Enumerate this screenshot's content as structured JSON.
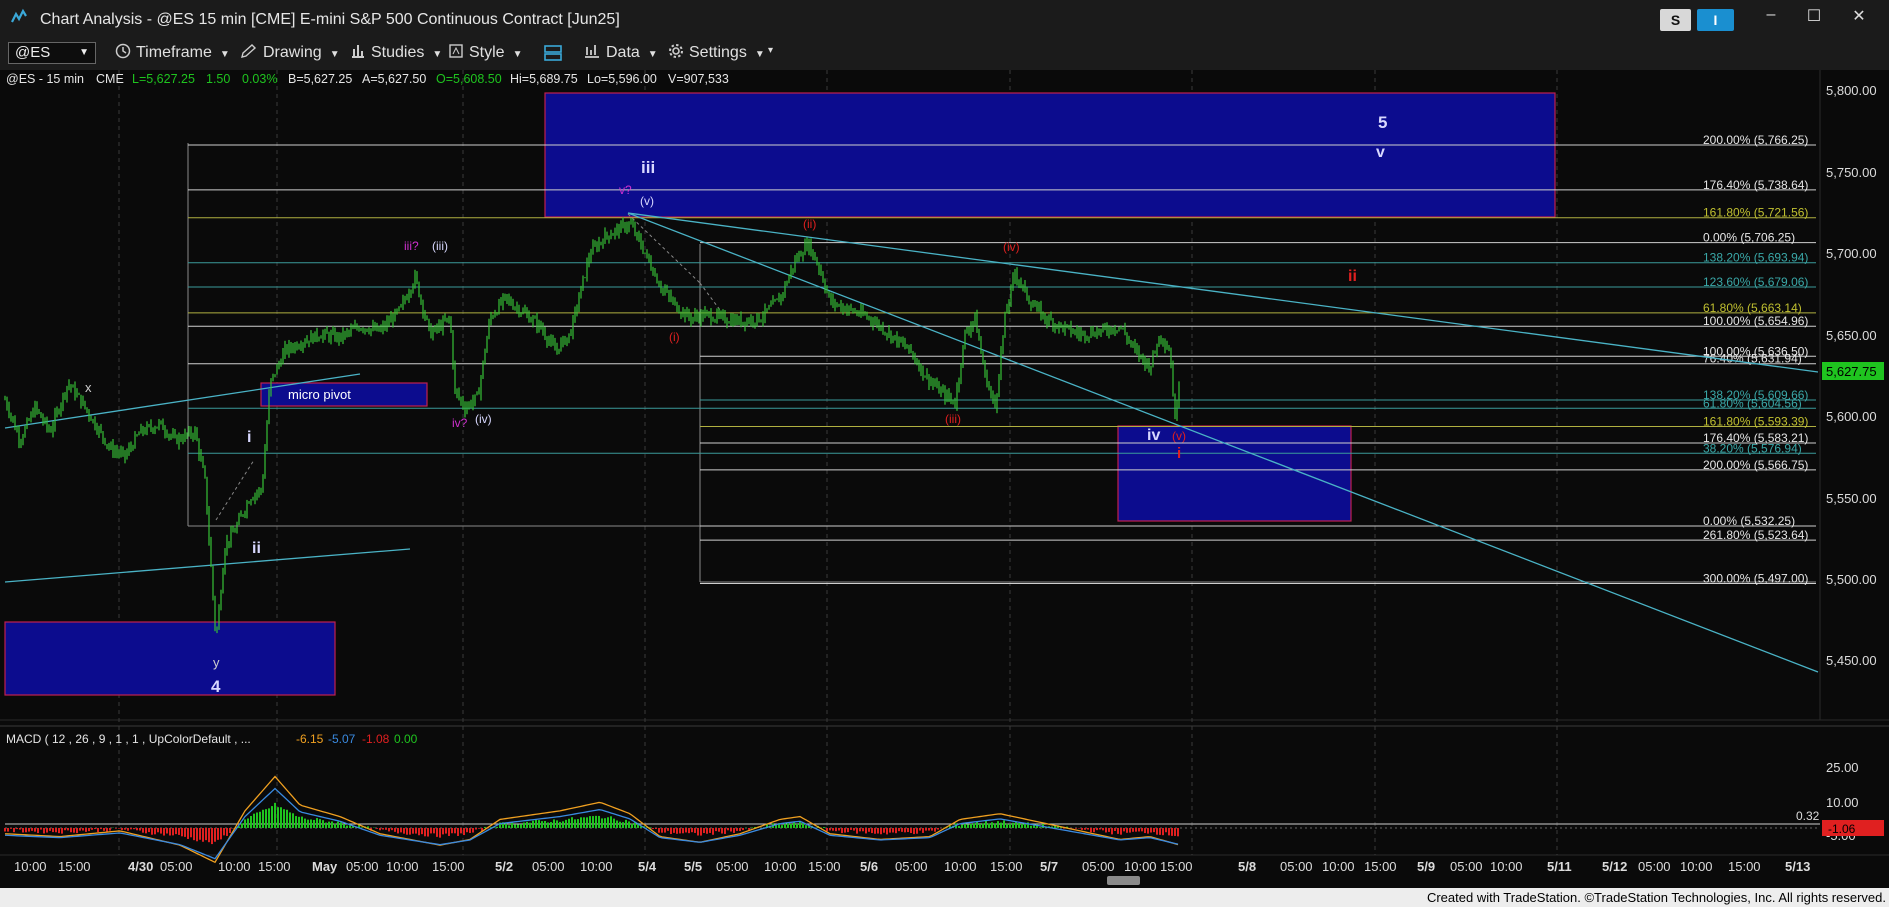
{
  "window": {
    "title": "Chart Analysis - @ES 15 min [CME] E-mini S&P 500 Continuous Contract [Jun25]",
    "buttons": {
      "s": "S",
      "i": "I"
    },
    "controls": {
      "minimize": "–",
      "maximize": "☐",
      "close": "✕"
    }
  },
  "toolbar": {
    "symbol": "@ES",
    "items": [
      {
        "label": "Timeframe",
        "icon": "clock-icon"
      },
      {
        "label": "Drawing",
        "icon": "pencil-icon"
      },
      {
        "label": "Studies",
        "icon": "studies-icon"
      },
      {
        "label": "Style",
        "icon": "style-icon"
      },
      {
        "label": "",
        "icon": "layout-icon"
      },
      {
        "label": "Data",
        "icon": "data-icon"
      },
      {
        "label": "Settings",
        "icon": "gear-icon"
      }
    ]
  },
  "header": {
    "symbol": "@ES - 15 min",
    "exchange": "CME",
    "last": "L=5,627.25",
    "change": "1.50",
    "pct": "0.03%",
    "bid": "B=5,627.25",
    "ask": "A=5,627.50",
    "open": "O=5,608.50",
    "high": "Hi=5,689.75",
    "low": "Lo=5,596.00",
    "volume": "V=907,533"
  },
  "macd": {
    "label": "MACD ( 12 , 26 , 9 , 1 , 1 , UpColorDefault , ...",
    "v1": "-6.15",
    "v2": "-5.07",
    "v3": "-1.08",
    "v4": "0.00",
    "axis": [
      "25.00",
      "10.00",
      "-5.00"
    ],
    "level": "0.32",
    "current": "-1.06"
  },
  "price_axis": {
    "ticks": [
      "5,800.00",
      "5,750.00",
      "5,700.00",
      "5,650.00",
      "5,600.00",
      "5,550.00",
      "5,500.00",
      "5,450.00"
    ],
    "current": "5,627.75"
  },
  "time_axis": [
    "10:00",
    "15:00",
    "4/30",
    "05:00",
    "10:00",
    "15:00",
    "May",
    "05:00",
    "10:00",
    "15:00",
    "5/2",
    "05:00",
    "10:00",
    "5/4",
    "5/5",
    "05:00",
    "10:00",
    "15:00",
    "5/6",
    "05:00",
    "10:00",
    "15:00",
    "5/7",
    "05:00",
    "10:00",
    "15:00",
    "5/8",
    "05:00",
    "10:00",
    "15:00",
    "5/9",
    "05:00",
    "10:00",
    "5/11",
    "5/12",
    "05:00",
    "10:00",
    "15:00",
    "5/13"
  ],
  "fib_labels": [
    "200.00% (5,766.25)",
    "176.40% (5,738.64)",
    "161.80% (5,721.56)",
    "0.00% (5,706.25)",
    "138.20% (5,693.94)",
    "123.60% (5,679.06)",
    "61.80% (5,663.14)",
    "100.00% (5,654.96)",
    "100.00% (5,636.50)",
    "76.40% (5,631.94)",
    "138.20% (5,609.66)",
    "61.80% (5,604.56)",
    "161.80% (5,593.39)",
    "176.40% (5,583.21)",
    "38.20% (5,576.94)",
    "200.00% (5,566.75)",
    "0.00% (5,532.25)",
    "261.80% (5,523.64)",
    "300.00% (5,497.00)"
  ],
  "wave_labels": {
    "x": "x",
    "y": "y",
    "four": "4",
    "i": "i",
    "ii": "ii",
    "iii": "iii",
    "iii_q": "iii?",
    "iii_p": "(iii)",
    "iv_q": "iv?",
    "iv_p": "(iv)",
    "v_q": "v?",
    "v_p": "(v)",
    "five": "5",
    "v": "v",
    "i_p": "(i)",
    "ii_p": "(ii)",
    "iii_r": "(iii)",
    "iv_r": "(iv)",
    "iv": "iv",
    "v_r": "(v)",
    "i_red": "i",
    "ii_red": "ii",
    "micro_pivot": "micro pivot"
  },
  "footer": {
    "credit": "Created with TradeStation. ©TradeStation Technologies, Inc. All rights reserved."
  },
  "colors": {
    "up": "#1fc41f",
    "down": "#e02020",
    "candle": "#35c035",
    "box": "#0c0c8e",
    "label_white": "#d8d8ff",
    "label_magenta": "#d030d0",
    "label_red": "#e02020",
    "trendline": "#4ab3c6"
  }
}
